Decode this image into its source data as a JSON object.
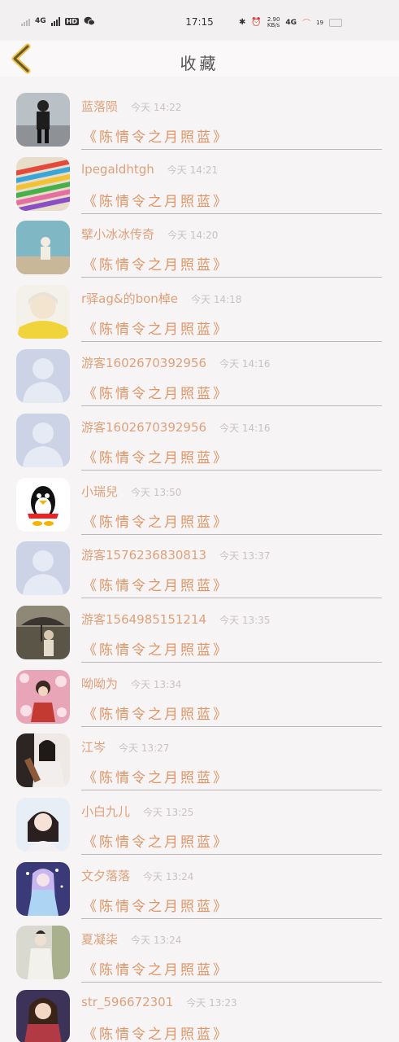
{
  "status": {
    "network": "4G",
    "network2": "4G",
    "hd": "HD",
    "time": "17:15",
    "rate_value": "2.90",
    "rate_unit": "KB/s",
    "battery": "19"
  },
  "nav": {
    "title": "收藏"
  },
  "colors": {
    "name": "#e0a07a",
    "book": "#e09566",
    "time": "#c9c2c2",
    "divider": "#bdb8b8"
  },
  "items": [
    {
      "user": "蓝落陨",
      "time": "今天 14:22",
      "book": "《陈情令之月照蓝》"
    },
    {
      "user": "lpegaldhtgh",
      "time": "今天 14:21",
      "book": "《陈情令之月照蓝》"
    },
    {
      "user": "擘小冰冰传奇",
      "time": "今天 14:20",
      "book": "《陈情令之月照蓝》"
    },
    {
      "user": "r驿ag&的bon棹e",
      "time": "今天 14:18",
      "book": "《陈情令之月照蓝》"
    },
    {
      "user": "游客1602670392956",
      "time": "今天 14:16",
      "book": "《陈情令之月照蓝》"
    },
    {
      "user": "游客1602670392956",
      "time": "今天 14:16",
      "book": "《陈情令之月照蓝》"
    },
    {
      "user": "小瑞兒",
      "time": "今天 13:50",
      "book": "《陈情令之月照蓝》"
    },
    {
      "user": "游客1576236830813",
      "time": "今天 13:37",
      "book": "《陈情令之月照蓝》"
    },
    {
      "user": "游客1564985151214",
      "time": "今天 13:35",
      "book": "《陈情令之月照蓝》"
    },
    {
      "user": "呦呦为",
      "time": "今天 13:34",
      "book": "《陈情令之月照蓝》"
    },
    {
      "user": "江岑",
      "time": "今天 13:27",
      "book": "《陈情令之月照蓝》"
    },
    {
      "user": "小白九儿",
      "time": "今天 13:25",
      "book": "《陈情令之月照蓝》"
    },
    {
      "user": "文夕落落",
      "time": "今天 13:24",
      "book": "《陈情令之月照蓝》"
    },
    {
      "user": "夏凝柒",
      "time": "今天 13:24",
      "book": "《陈情令之月照蓝》"
    },
    {
      "user": "str_596672301",
      "time": "今天 13:23",
      "book": "《陈情令之月照蓝》"
    }
  ]
}
